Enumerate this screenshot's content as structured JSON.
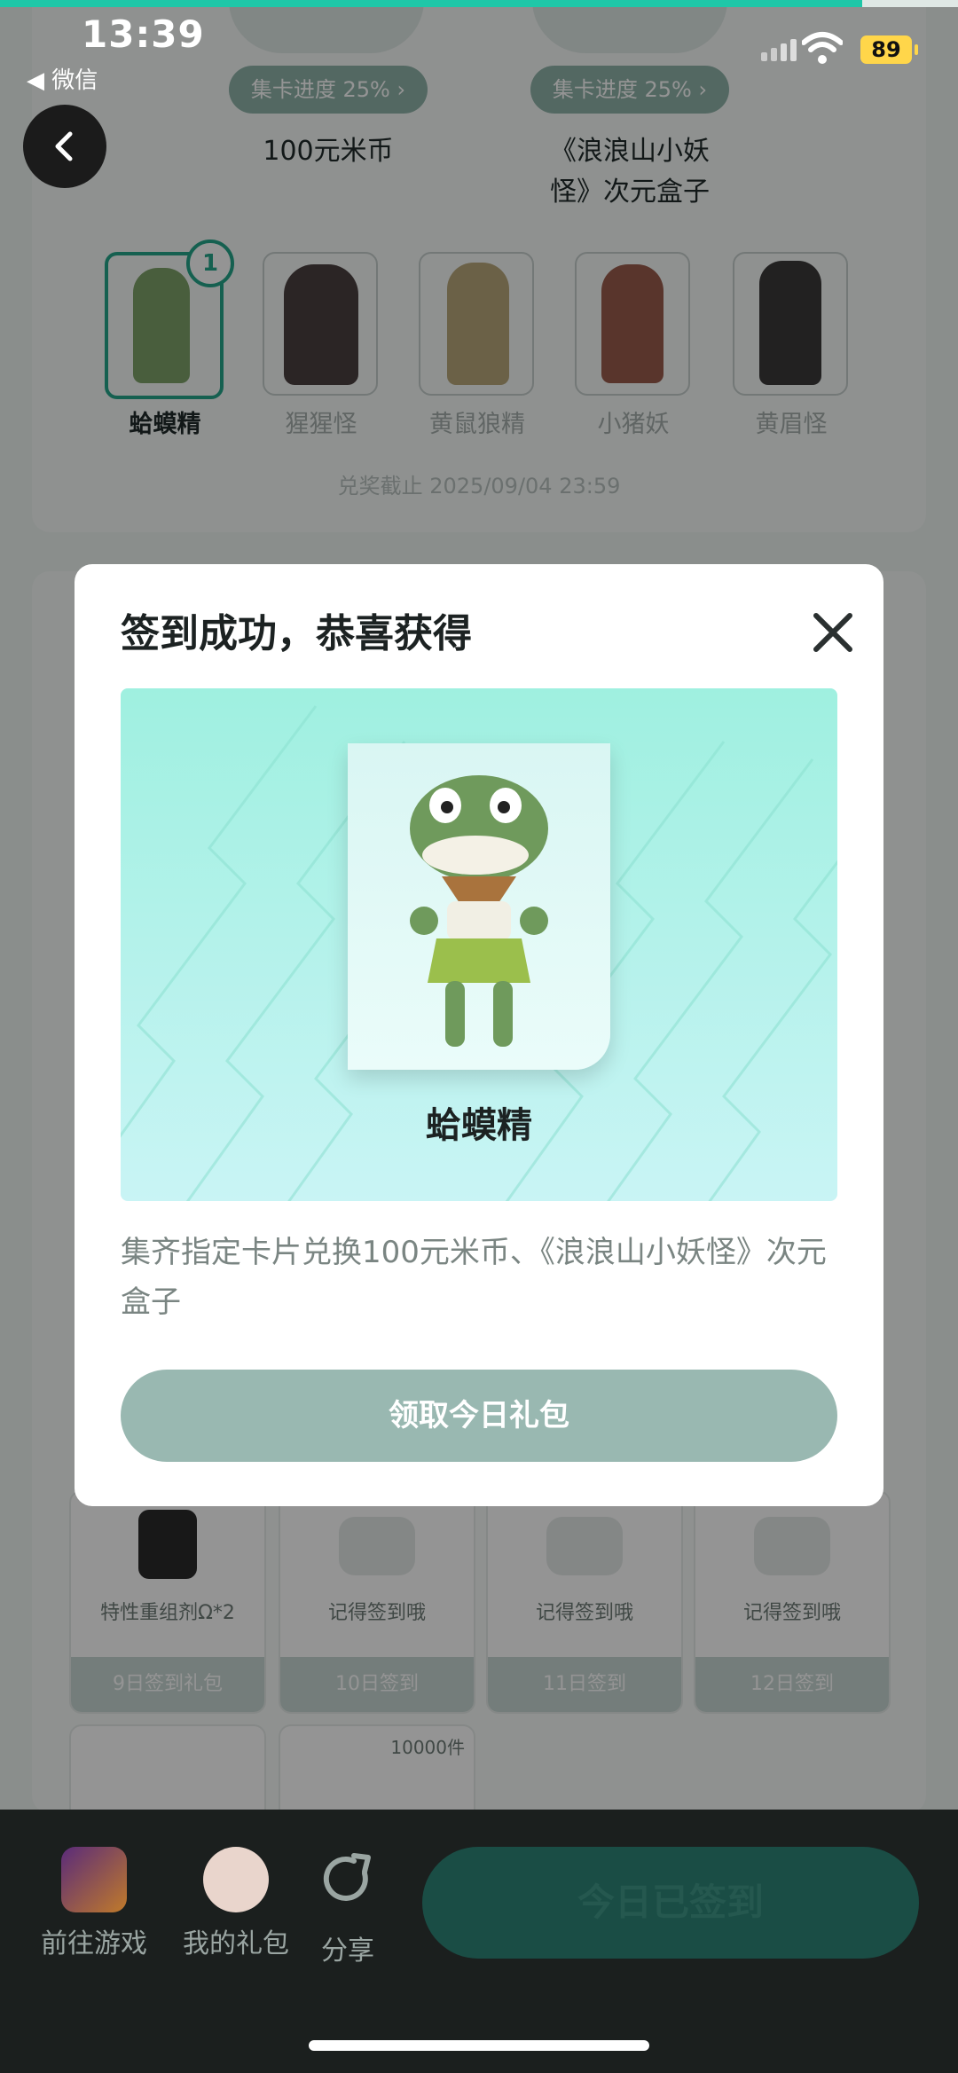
{
  "status_bar": {
    "time": "13:39",
    "back_app": "◀ 微信",
    "battery": "89"
  },
  "top_progress": {
    "fraction": 0.9
  },
  "prizes": [
    {
      "badge": "集卡进度 25% ›",
      "name": "100元米币"
    },
    {
      "badge": "集卡进度 25% ›",
      "name_line1": "《浪浪山小妖",
      "name_line2": "怪》次元盒子"
    }
  ],
  "cards": [
    {
      "label": "蛤蟆精",
      "count": "1"
    },
    {
      "label": "猩猩怪"
    },
    {
      "label": "黄鼠狼精"
    },
    {
      "label": "小猪妖"
    },
    {
      "label": "黄眉怪"
    }
  ],
  "deadline": "兑奖截止 2025/09/04 23:59",
  "gifts": [
    {
      "title": "特性重组剂Ω*2",
      "foot": "9日签到礼包"
    },
    {
      "title": "记得签到哦",
      "foot": "10日签到"
    },
    {
      "title": "记得签到哦",
      "foot": "11日签到"
    },
    {
      "title": "记得签到哦",
      "foot": "12日签到"
    }
  ],
  "stock_label": "10000件",
  "modal": {
    "title": "签到成功，恭喜获得",
    "card_name": "蛤蟆精",
    "desc": "集齐指定卡片兑换100元米币、《浪浪山小妖怪》次元盒子",
    "button": "领取今日礼包"
  },
  "bottom_bar": {
    "go_game": "前往游戏",
    "my_gifts": "我的礼包",
    "share": "分享",
    "signed": "今日已签到"
  }
}
